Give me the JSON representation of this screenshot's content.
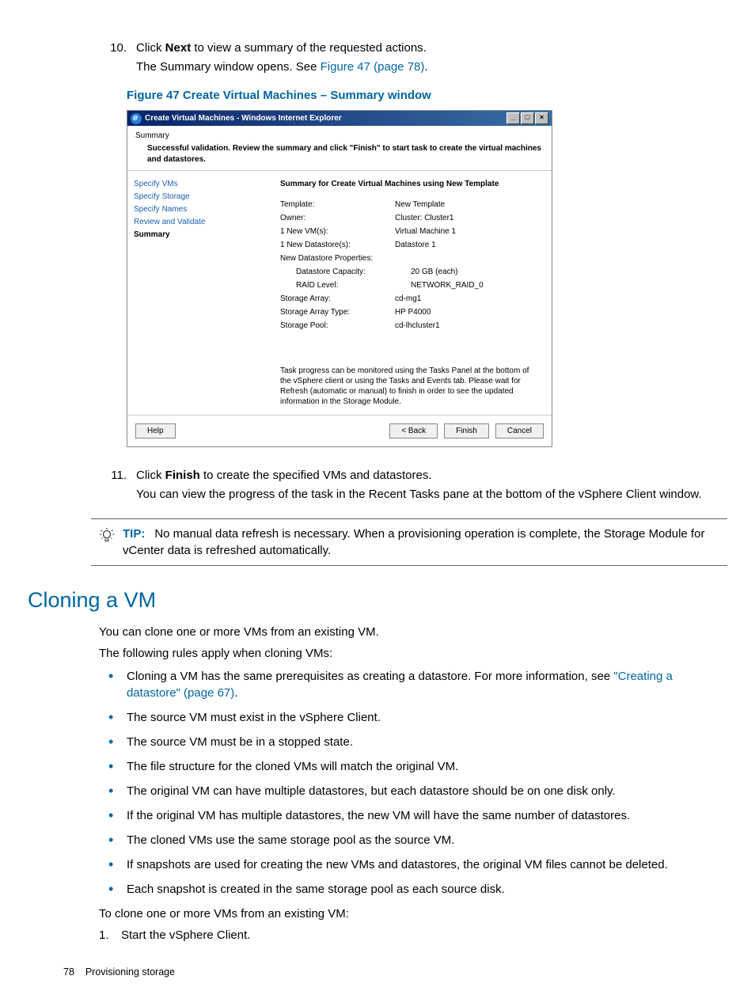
{
  "steps": {
    "s10_num": "10.",
    "s10_text_pre": "Click ",
    "s10_bold": "Next",
    "s10_text_post": " to view a summary of the requested actions.",
    "s10_line2_pre": "The Summary window opens. See ",
    "s10_link": "Figure 47 (page 78)",
    "s10_line2_post": ".",
    "s11_num": "11.",
    "s11_text_pre": "Click ",
    "s11_bold": "Finish",
    "s11_text_post": " to create the specified VMs and datastores.",
    "s11_line2": "You can view the progress of the task in the Recent Tasks pane at the bottom of the vSphere Client window."
  },
  "figure_caption": "Figure 47 Create Virtual Machines – Summary window",
  "screenshot": {
    "title": "Create Virtual Machines - Windows Internet Explorer",
    "winbtns": {
      "min": "_",
      "max": "□",
      "close": "×"
    },
    "header_title": "Summary",
    "header_sub": "Successful validation. Review the summary and click \"Finish\" to start task to create the virtual machines and datastores.",
    "nav": [
      "Specify VMs",
      "Specify Storage",
      "Specify Names",
      "Review and Validate",
      "Summary"
    ],
    "content_title": "Summary for Create Virtual Machines using New Template",
    "kv": [
      {
        "k": "Template:",
        "v": "New Template"
      },
      {
        "k": "Owner:",
        "v": "Cluster: Cluster1"
      },
      {
        "k": "1 New VM(s):",
        "v": "Virtual Machine 1"
      },
      {
        "k": "1 New Datastore(s):",
        "v": "Datastore 1"
      },
      {
        "k": "New Datastore Properties:",
        "v": ""
      },
      {
        "k": "Datastore Capacity:",
        "v": "20 GB (each)",
        "indent": true
      },
      {
        "k": "RAID Level:",
        "v": "NETWORK_RAID_0",
        "indent": true
      },
      {
        "k": "Storage Array:",
        "v": "cd-mg1"
      },
      {
        "k": "Storage Array Type:",
        "v": "HP P4000"
      },
      {
        "k": "Storage Pool:",
        "v": "cd-lhcluster1"
      }
    ],
    "note": "Task progress can be monitored using the Tasks Panel at the bottom of the vSphere client or using the Tasks and Events tab. Please wait for Refresh (automatic or manual) to finish in order to see the updated information in the Storage Module.",
    "buttons": {
      "help": "Help",
      "back": "< Back",
      "finish": "Finish",
      "cancel": "Cancel"
    }
  },
  "tip": {
    "label": "TIP:",
    "text": "No manual data refresh is necessary. When a provisioning operation is complete, the Storage Module for vCenter data is refreshed automatically."
  },
  "section_heading": "Cloning a VM",
  "section_p1": "You can clone one or more VMs from an existing VM.",
  "section_p2": "The following rules apply when cloning VMs:",
  "bullets": [
    {
      "pre": "Cloning a VM has the same prerequisites as creating a datastore. For more information, see ",
      "link": "\"Creating a datastore\" (page 67)",
      "post": "."
    },
    {
      "text": "The source VM must exist in the vSphere Client."
    },
    {
      "text": "The source VM must be in a stopped state."
    },
    {
      "text": "The file structure for the cloned VMs will match the original VM."
    },
    {
      "text": "The original VM can have multiple datastores, but each datastore should be on one disk only."
    },
    {
      "text": "If the original VM has multiple datastores, the new VM will have the same number of datastores."
    },
    {
      "text": "The cloned VMs use the same storage pool as the source VM."
    },
    {
      "text": "If snapshots are used for creating the new VMs and datastores, the original VM files cannot be deleted."
    },
    {
      "text": "Each snapshot is created in the same storage pool as each source disk."
    }
  ],
  "section_p3": "To clone one or more VMs from an existing VM:",
  "numlist": [
    {
      "n": "1.",
      "t": "Start the vSphere Client."
    }
  ],
  "footer": {
    "page": "78",
    "section": "Provisioning storage"
  }
}
